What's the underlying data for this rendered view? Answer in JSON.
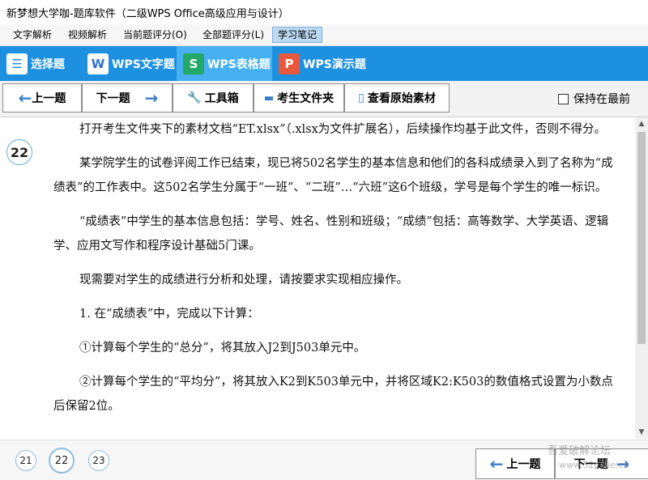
{
  "window": {
    "title": "新梦想大学咖-题库软件（二级WPS Office高级应用与设计）"
  },
  "menu": [
    {
      "label": "文字解析"
    },
    {
      "label": "视频解析"
    },
    {
      "label": "当前题评分(O)"
    },
    {
      "label": "全部题评分(L)"
    },
    {
      "label": "学习笔记",
      "active": true
    }
  ],
  "categories": [
    {
      "label": "选择题",
      "icon": "checklist-icon",
      "glyph": "☰",
      "color": "#ffffff"
    },
    {
      "label": "WPS文字题",
      "icon": "wps-writer-icon",
      "glyph": "W",
      "color": "#2f6fd4"
    },
    {
      "label": "WPS表格题",
      "icon": "wps-spreadsheet-icon",
      "glyph": "S",
      "color": "#23a867"
    },
    {
      "label": "WPS演示题",
      "icon": "wps-presentation-icon",
      "glyph": "P",
      "color": "#e8583c"
    }
  ],
  "toolbar": {
    "prev": "上一题",
    "next": "下一题",
    "toolbox": "工具箱",
    "student_folder": "考生文件夹",
    "view_material": "查看原始素材",
    "keep_on_top": "保持在最前"
  },
  "question": {
    "number": "22",
    "paragraphs": [
      "打开考生文件夹下的素材文档“ET.xlsx”（.xlsx为文件扩展名），后续操作均基于此文件，否则不得分。",
      "某学院学生的试卷评阅工作已结束，现已将502名学生的基本信息和他们的各科成绩录入到了名称为“成绩表”的工作表中。这502名学生分属于“一班”、“二班”…“六班”这6个班级，学号是每个学生的唯一标识。",
      "“成绩表”中学生的基本信息包括：学号、姓名、性别和班级；“成绩”包括：高等数学、大学英语、逻辑学、应用文写作和程序设计基础5门课。",
      "现需要对学生的成绩进行分析和处理，请按要求实现相应操作。",
      "1. 在“成绩表”中，完成以下计算：",
      "①计算每个学生的“总分”，将其放入J2到J503单元中。",
      "②计算每个学生的“平均分”，将其放入K2到K503单元中，并将区域K2:K503的数值格式设置为小数点后保留2位。"
    ]
  },
  "pager": {
    "prev_page": "21",
    "current_page": "22",
    "next_page": "23"
  },
  "bottom_nav": {
    "prev": "上一题",
    "next": "下一题"
  },
  "watermark": {
    "line1": "吾爱破解论坛",
    "line2": "www.52pojie.cn"
  }
}
